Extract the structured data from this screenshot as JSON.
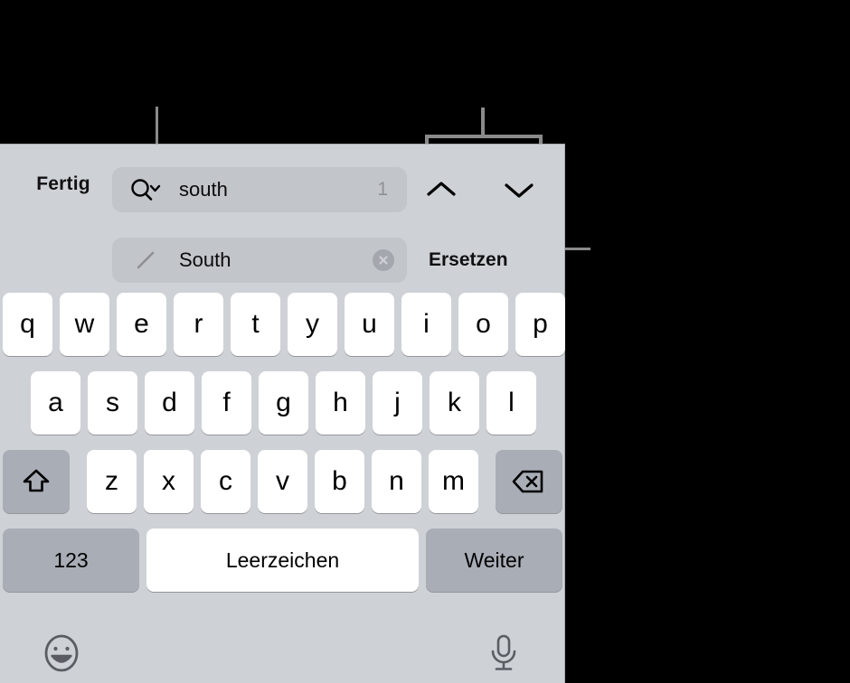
{
  "panel": {
    "background_color": "#ced1d6",
    "key_color": "#ffffff",
    "modifier_key_color": "#a9adb6",
    "field_color": "#c2c5ca"
  },
  "findbar": {
    "done_label": "Fertig",
    "search": {
      "icon": "search-chevron-icon",
      "value": "south",
      "match_count": "1"
    },
    "replace": {
      "icon": "pencil-icon",
      "value": "South",
      "clear_icon": "clear-circle-icon"
    },
    "nav": {
      "prev_icon": "chevron-up-icon",
      "next_icon": "chevron-down-icon"
    },
    "replace_label": "Ersetzen"
  },
  "keyboard": {
    "row1": [
      {
        "label": "q"
      },
      {
        "label": "w"
      },
      {
        "label": "e"
      },
      {
        "label": "r"
      },
      {
        "label": "t"
      },
      {
        "label": "y"
      },
      {
        "label": "u"
      },
      {
        "label": "i"
      },
      {
        "label": "o"
      },
      {
        "label": "p"
      }
    ],
    "row2": [
      {
        "label": "a"
      },
      {
        "label": "s"
      },
      {
        "label": "d"
      },
      {
        "label": "f"
      },
      {
        "label": "g"
      },
      {
        "label": "h"
      },
      {
        "label": "j"
      },
      {
        "label": "k"
      },
      {
        "label": "l"
      }
    ],
    "row3": {
      "shift_icon": "shift-arrow-icon",
      "letters": [
        {
          "label": "z"
        },
        {
          "label": "x"
        },
        {
          "label": "c"
        },
        {
          "label": "v"
        },
        {
          "label": "b"
        },
        {
          "label": "n"
        },
        {
          "label": "m"
        }
      ],
      "backspace_icon": "backspace-icon"
    },
    "row4": {
      "numbers_label": "123",
      "space_label": "Leerzeichen",
      "next_label": "Weiter"
    }
  },
  "accessory": {
    "emoji_icon": "emoji-smiley-icon",
    "mic_icon": "microphone-icon"
  }
}
